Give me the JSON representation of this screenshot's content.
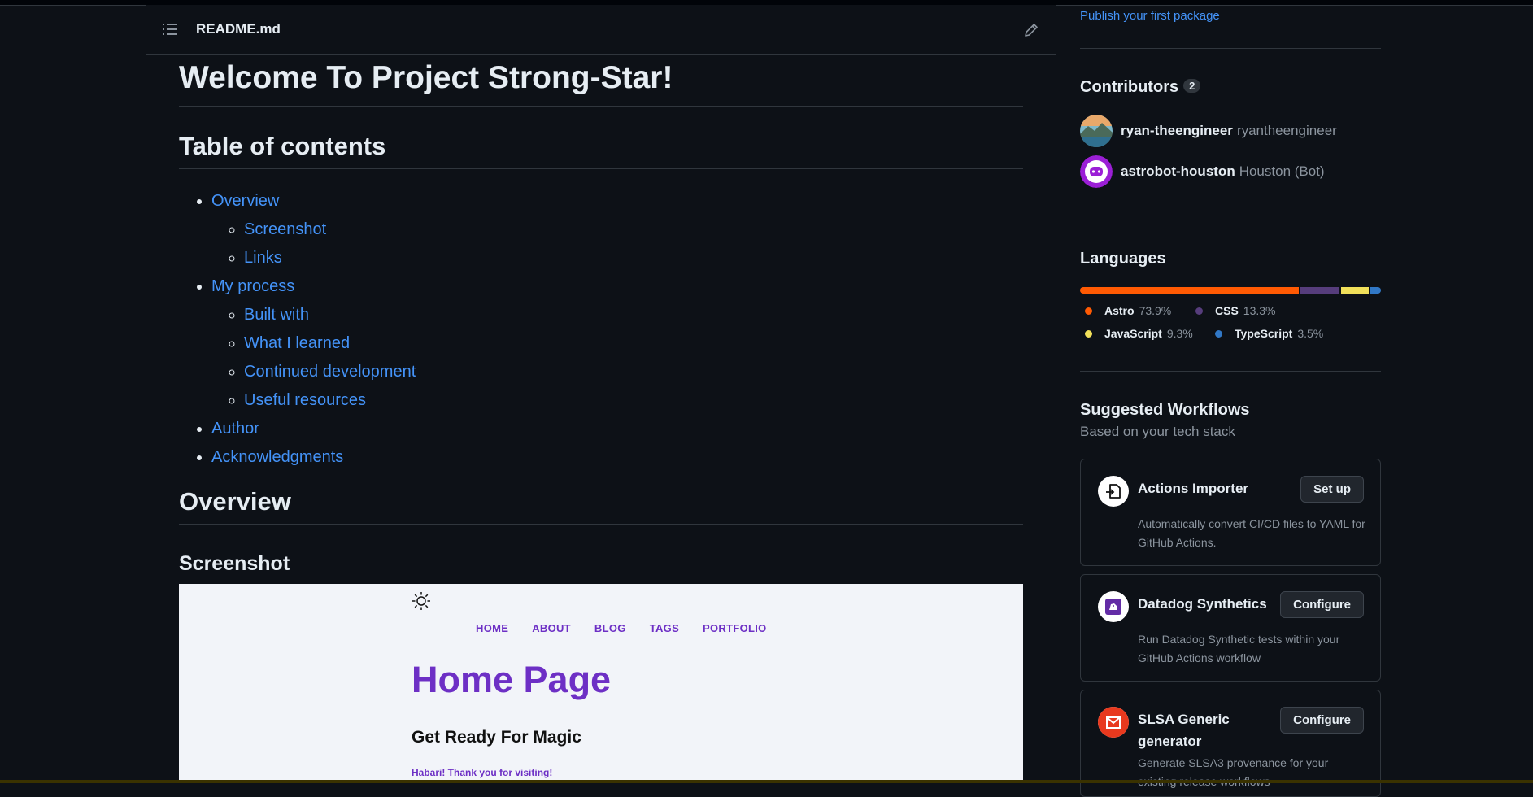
{
  "readme": {
    "filename": "README.md",
    "title": "Welcome To Project Strong-Star!",
    "toc_heading": "Table of contents",
    "toc": [
      {
        "label": "Overview",
        "children": [
          "Screenshot",
          "Links"
        ]
      },
      {
        "label": "My process",
        "children": [
          "Built with",
          "What I learned",
          "Continued development",
          "Useful resources"
        ]
      },
      {
        "label": "Author",
        "children": []
      },
      {
        "label": "Acknowledgments",
        "children": []
      }
    ],
    "overview_heading": "Overview",
    "screenshot_heading": "Screenshot",
    "screenshot": {
      "nav": [
        "HOME",
        "ABOUT",
        "BLOG",
        "TAGS",
        "PORTFOLIO"
      ],
      "heading": "Home Page",
      "subheading": "Get Ready For Magic",
      "text": "Habari! Thank you for visiting!"
    }
  },
  "sidebar": {
    "publish_link": "Publish your first package",
    "contributors": {
      "title": "Contributors",
      "count": "2",
      "people": [
        {
          "login": "ryan-theengineer",
          "name": "ryantheengineer"
        },
        {
          "login": "astrobot-houston",
          "name": "Houston (Bot)"
        }
      ]
    },
    "languages": {
      "title": "Languages",
      "items": [
        {
          "name": "Astro",
          "pct": "73.9%",
          "value": 73.9,
          "color": "#ff5a03"
        },
        {
          "name": "CSS",
          "pct": "13.3%",
          "value": 13.3,
          "color": "#563d7c"
        },
        {
          "name": "JavaScript",
          "pct": "9.3%",
          "value": 9.3,
          "color": "#f1e05a"
        },
        {
          "name": "TypeScript",
          "pct": "3.5%",
          "value": 3.5,
          "color": "#3178c6"
        }
      ]
    },
    "workflows": {
      "title": "Suggested Workflows",
      "subtitle": "Based on your tech stack",
      "items": [
        {
          "title": "Actions Importer",
          "button": "Set up",
          "desc": "Automatically convert CI/CD files to YAML for GitHub Actions."
        },
        {
          "title": "Datadog Synthetics",
          "button": "Configure",
          "desc": "Run Datadog Synthetic tests within your GitHub Actions workflow"
        },
        {
          "title": "SLSA Generic generator",
          "button": "Configure",
          "desc": "Generate SLSA3 provenance for your existing release workflows"
        }
      ]
    }
  }
}
